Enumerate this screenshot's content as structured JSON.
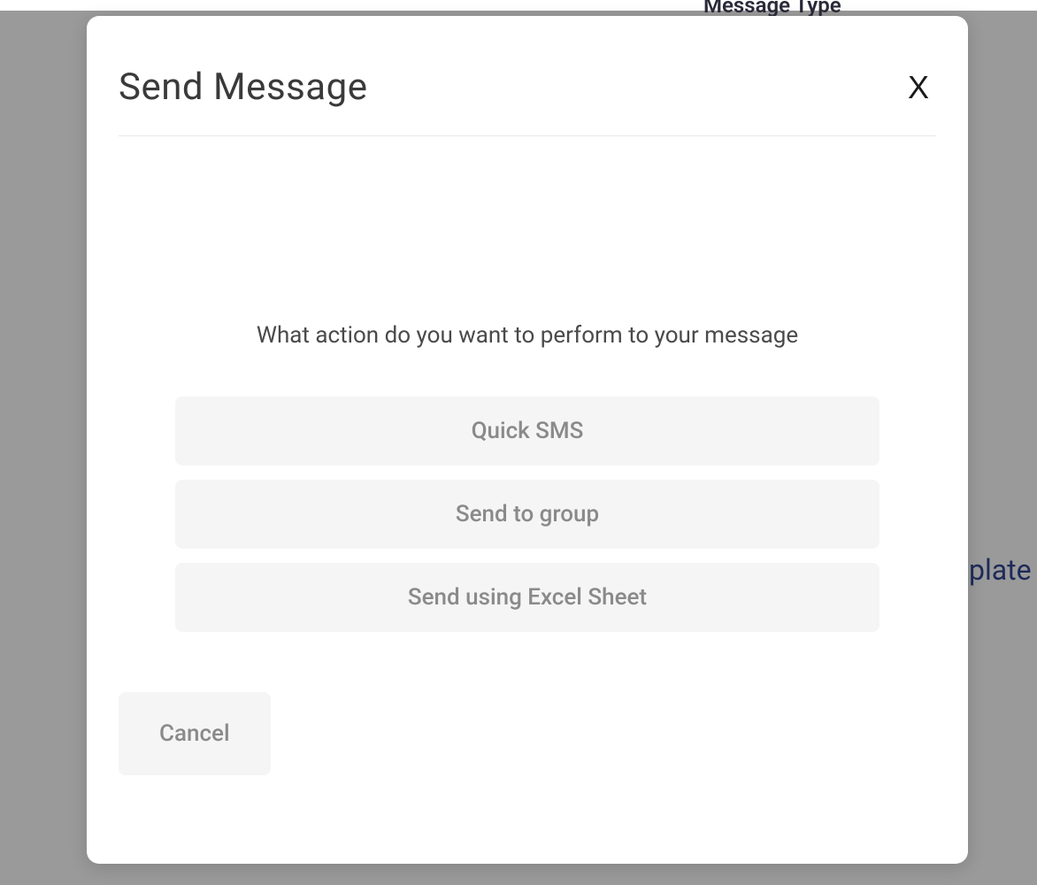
{
  "background": {
    "top_label": "Message Type",
    "side_label": "plate"
  },
  "modal": {
    "title": "Send Message",
    "close_label": "X",
    "prompt": "What action do you want to perform to your message",
    "options": [
      "Quick SMS",
      "Send to group",
      "Send using Excel Sheet"
    ],
    "cancel_label": "Cancel"
  }
}
